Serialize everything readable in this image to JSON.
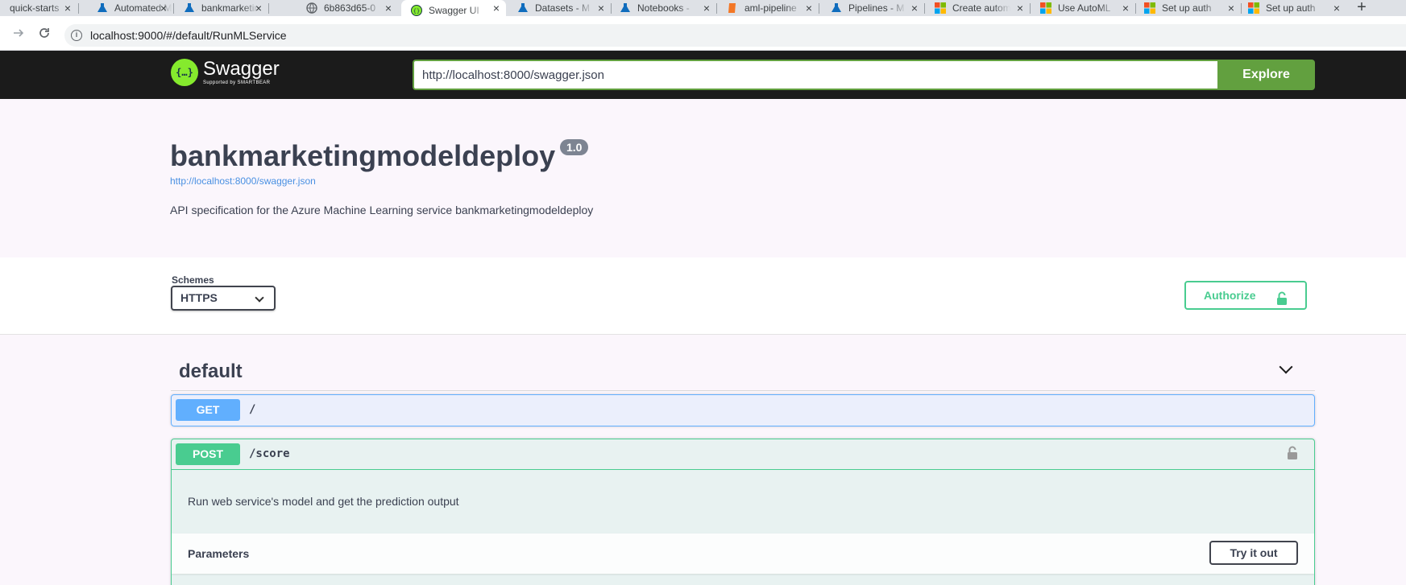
{
  "browser": {
    "tabs": [
      {
        "title": "quick-starts",
        "icon": "azure-ml-icon"
      },
      {
        "title": "Automated ML",
        "icon": "azure-ml-flask-icon"
      },
      {
        "title": "bankmarketing",
        "icon": "azure-ml-flask-icon"
      },
      {
        "title": "6b863d65-0",
        "icon": "globe-icon"
      },
      {
        "title": "Swagger UI",
        "icon": "swagger-icon"
      },
      {
        "title": "Datasets - M",
        "icon": "azure-ml-flask-icon"
      },
      {
        "title": "Notebooks -",
        "icon": "azure-ml-flask-icon"
      },
      {
        "title": "aml-pipeline",
        "icon": "jupyter-book-icon"
      },
      {
        "title": "Pipelines - M",
        "icon": "azure-ml-flask-icon"
      },
      {
        "title": "Create autom",
        "icon": "microsoft-logo-icon"
      },
      {
        "title": "Use AutoML",
        "icon": "microsoft-logo-icon"
      },
      {
        "title": "Set up auth",
        "icon": "microsoft-logo-icon"
      },
      {
        "title": "Set up auth",
        "icon": "microsoft-logo-icon"
      }
    ],
    "close_glyph": "×",
    "new_tab_glyph": "+",
    "address_url": "localhost:9000/#/default/RunMLService"
  },
  "topbar": {
    "logo_name": "Swagger",
    "logo_sub": "Supported by SMARTBEAR",
    "spec_url_value": "http://localhost:8000/swagger.json",
    "explore_label": "Explore"
  },
  "info": {
    "title": "bankmarketingmodeldeploy",
    "version": "1.0",
    "spec_link": "http://localhost:8000/swagger.json",
    "description": "API specification for the Azure Machine Learning service bankmarketingmodeldeploy"
  },
  "schemes": {
    "label": "Schemes",
    "selected": "HTTPS",
    "authorize_label": "Authorize"
  },
  "operations": {
    "tag": "default",
    "get": {
      "method": "GET",
      "path": "/"
    },
    "post": {
      "method": "POST",
      "path": "/score",
      "description": "Run web service's model and get the prediction output",
      "parameters_title": "Parameters",
      "try_label": "Try it out"
    }
  },
  "colors": {
    "get": "#61affe",
    "post": "#49cc90",
    "explore": "#62a03f",
    "topbar": "#1b1b1b"
  }
}
